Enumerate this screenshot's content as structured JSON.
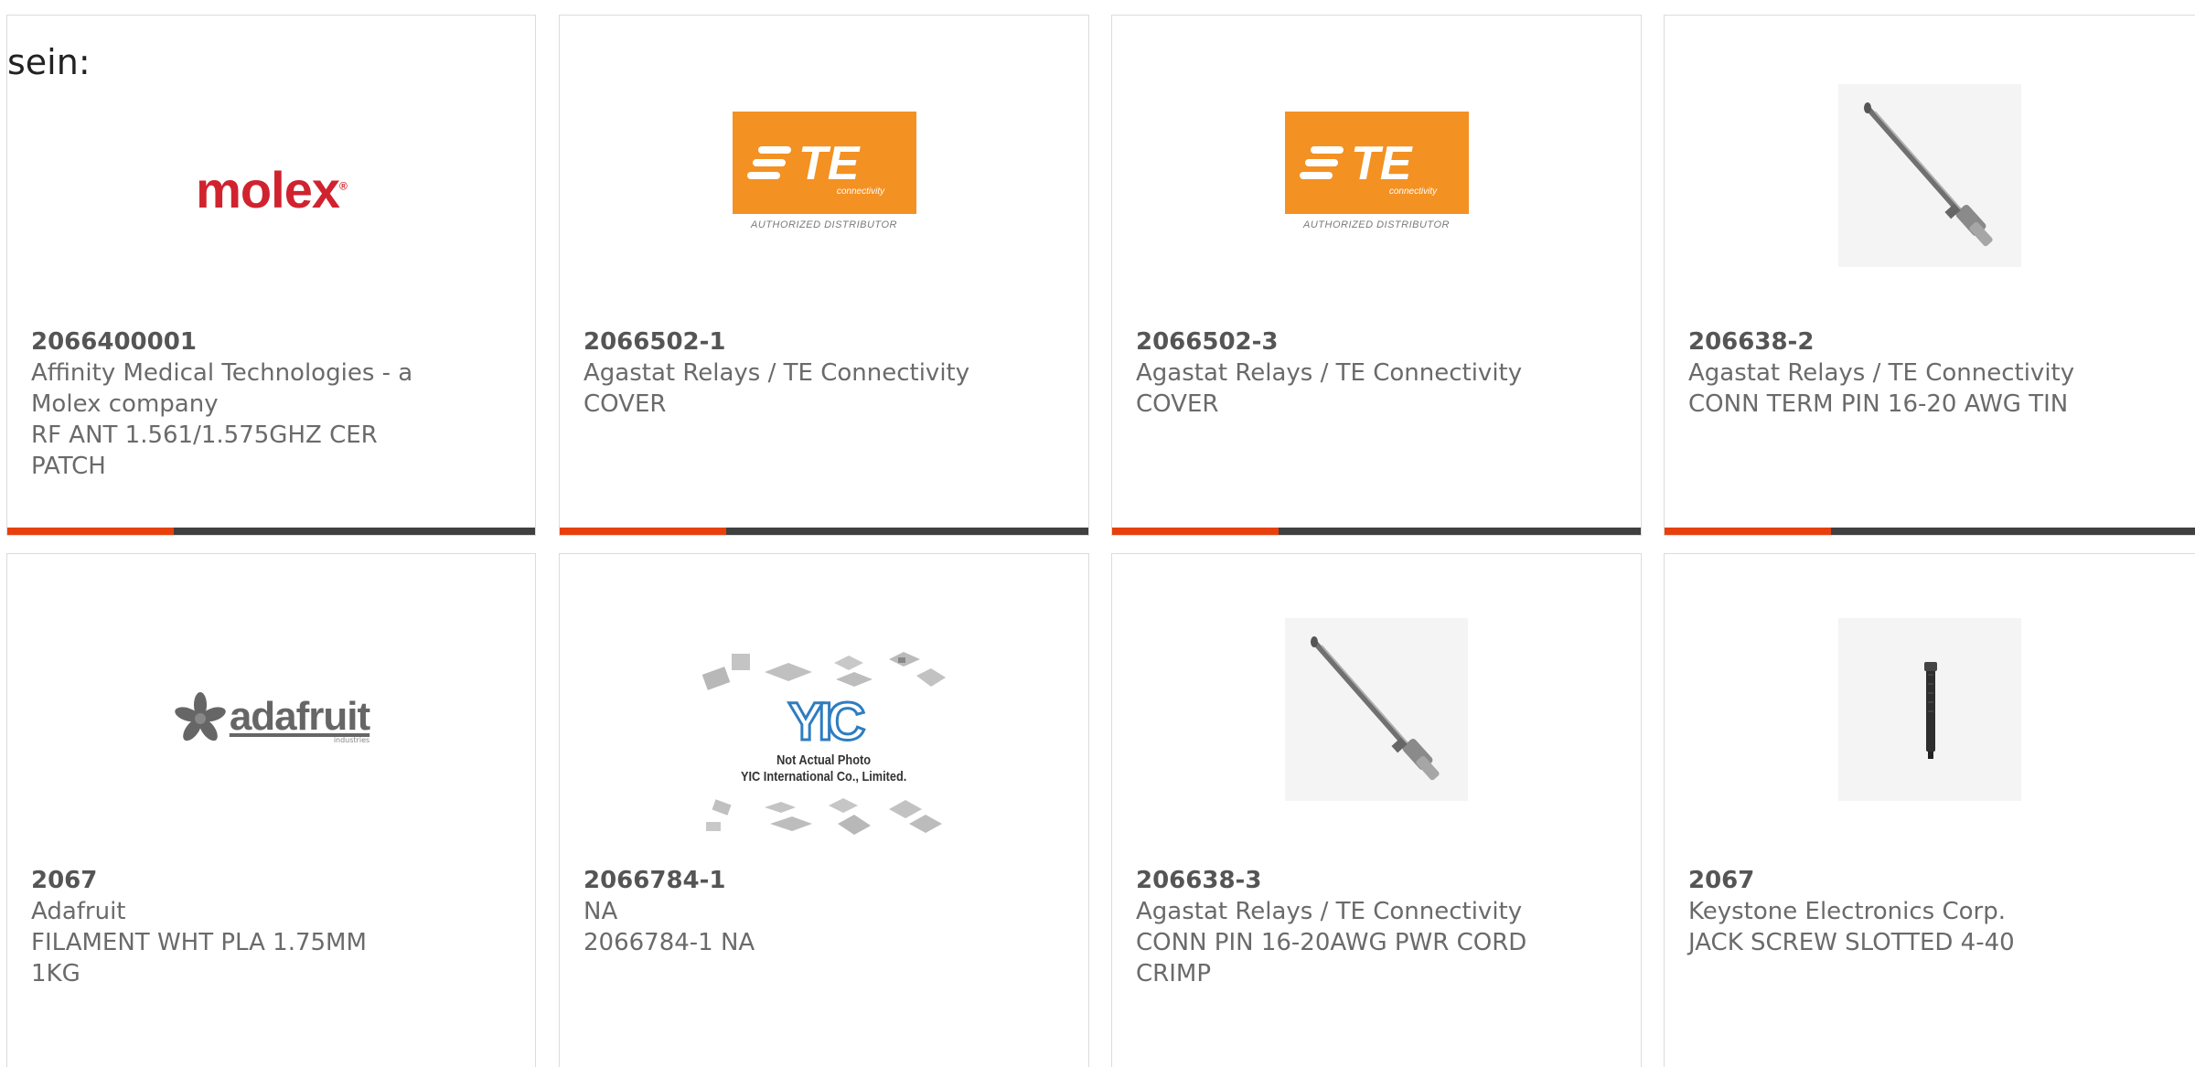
{
  "header": {
    "label": "sein:"
  },
  "cards": [
    {
      "part_number": "2066400001",
      "manufacturer": "Affinity Medical Technologies - a Molex company",
      "description": "RF ANT 1.561/1.575GHZ CER PATCH",
      "logo": {
        "text": "molex",
        "mark": "®"
      }
    },
    {
      "part_number": "2066502-1",
      "manufacturer": "Agastat Relays / TE Connectivity",
      "description": "COVER",
      "logo": {
        "text": "TE",
        "sub": "connectivity",
        "caption": "AUTHORIZED DISTRIBUTOR"
      }
    },
    {
      "part_number": "2066502-3",
      "manufacturer": "Agastat Relays / TE Connectivity",
      "description": "COVER",
      "logo": {
        "text": "TE",
        "sub": "connectivity",
        "caption": "AUTHORIZED DISTRIBUTOR"
      }
    },
    {
      "part_number": "206638-2",
      "manufacturer": "Agastat Relays / TE Connectivity",
      "description": "CONN TERM PIN 16-20 AWG TIN"
    },
    {
      "part_number": "2067",
      "manufacturer": "Adafruit",
      "description": "FILAMENT WHT PLA 1.75MM 1KG",
      "logo": {
        "text": "adafruit",
        "sub": "industries"
      }
    },
    {
      "part_number": "2066784-1",
      "manufacturer": "NA",
      "description": "2066784-1 NA",
      "logo": {
        "text": "YIC",
        "caption_1": "Not Actual Photo",
        "caption_2": "YIC International Co., Limited."
      }
    },
    {
      "part_number": "206638-3",
      "manufacturer": "Agastat Relays / TE Connectivity",
      "description": "CONN PIN 16-20AWG PWR CORD CRIMP"
    },
    {
      "part_number": "2067",
      "manufacturer": "Keystone Electronics Corp.",
      "description": "JACK SCREW SLOTTED 4-40"
    }
  ],
  "colors": {
    "accent": "#e8400c",
    "bar": "#404040",
    "text": "#6a6a6a",
    "molex_red": "#d0232f",
    "te_orange": "#f39123"
  }
}
